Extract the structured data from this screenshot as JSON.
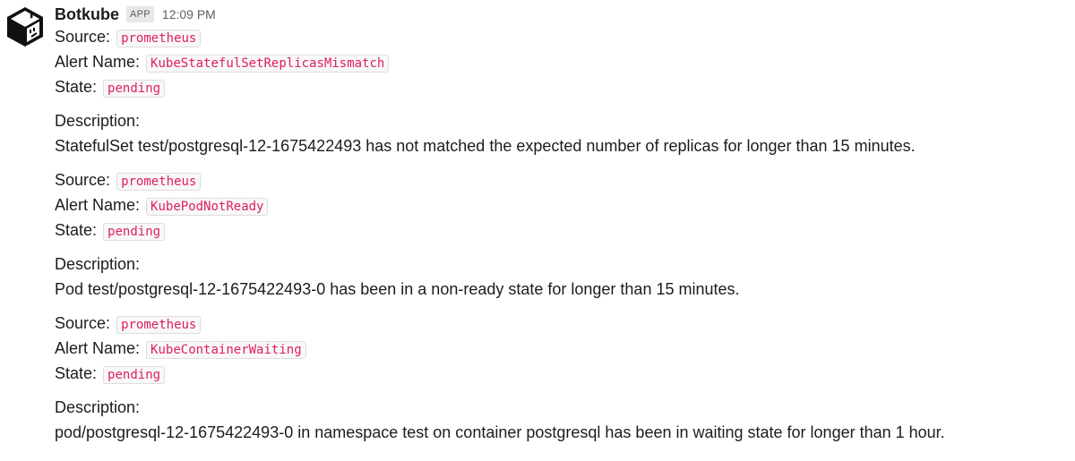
{
  "message": {
    "sender": "Botkube",
    "badge": "APP",
    "time": "12:09 PM"
  },
  "labels": {
    "source": "Source:",
    "alert_name": "Alert Name:",
    "state": "State:",
    "description": "Description:"
  },
  "alerts": [
    {
      "source": "prometheus",
      "alert_name": "KubeStatefulSetReplicasMismatch",
      "state": "pending",
      "description": "StatefulSet test/postgresql-12-1675422493 has not matched the expected number of replicas for longer than 15 minutes."
    },
    {
      "source": "prometheus",
      "alert_name": "KubePodNotReady",
      "state": "pending",
      "description": "Pod test/postgresql-12-1675422493-0 has been in a non-ready state for longer than 15 minutes."
    },
    {
      "source": "prometheus",
      "alert_name": "KubeContainerWaiting",
      "state": "pending",
      "description": "pod/postgresql-12-1675422493-0 in namespace test on container postgresql has been in waiting state for longer than 1 hour."
    }
  ],
  "icons": {
    "avatar": "botkube-logo-icon"
  }
}
